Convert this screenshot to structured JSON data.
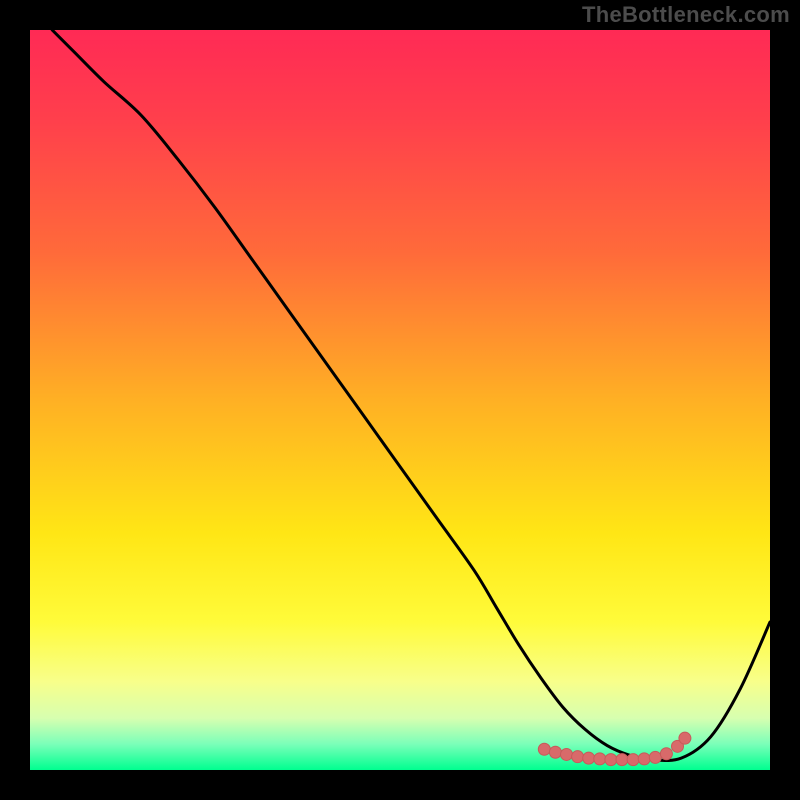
{
  "watermark": "TheBottleneck.com",
  "colors": {
    "background": "#000000",
    "gradient_stops": [
      {
        "offset": 0.0,
        "color": "#ff2a55"
      },
      {
        "offset": 0.12,
        "color": "#ff3f4c"
      },
      {
        "offset": 0.3,
        "color": "#ff6a3a"
      },
      {
        "offset": 0.5,
        "color": "#ffb024"
      },
      {
        "offset": 0.68,
        "color": "#ffe615"
      },
      {
        "offset": 0.8,
        "color": "#fffb3a"
      },
      {
        "offset": 0.88,
        "color": "#f8ff8a"
      },
      {
        "offset": 0.93,
        "color": "#d7ffb0"
      },
      {
        "offset": 0.965,
        "color": "#7bffb9"
      },
      {
        "offset": 1.0,
        "color": "#00ff90"
      }
    ],
    "curve": "#000000",
    "marker_fill": "#d86a6a",
    "marker_stroke": "#c75a5a"
  },
  "chart_data": {
    "type": "line",
    "title": "",
    "xlabel": "",
    "ylabel": "",
    "xlim": [
      0,
      100
    ],
    "ylim": [
      0,
      100
    ],
    "series": [
      {
        "name": "curve",
        "x": [
          3,
          6,
          10,
          15,
          20,
          25,
          30,
          35,
          40,
          45,
          50,
          55,
          60,
          63,
          66,
          69,
          72,
          75,
          78,
          81,
          84,
          88,
          92,
          96,
          100
        ],
        "values": [
          100,
          97,
          93,
          88.5,
          82.5,
          76,
          69,
          62,
          55,
          48,
          41,
          34,
          27,
          22,
          17,
          12.5,
          8.5,
          5.5,
          3.3,
          2.0,
          1.4,
          1.6,
          4.5,
          11,
          20
        ]
      }
    ],
    "markers": {
      "name": "bottom-cluster",
      "x": [
        69.5,
        71,
        72.5,
        74,
        75.5,
        77,
        78.5,
        80,
        81.5,
        83,
        84.5,
        86,
        87.5,
        88.5
      ],
      "values": [
        2.8,
        2.4,
        2.1,
        1.8,
        1.6,
        1.5,
        1.4,
        1.4,
        1.4,
        1.5,
        1.7,
        2.2,
        3.2,
        4.3
      ]
    }
  }
}
